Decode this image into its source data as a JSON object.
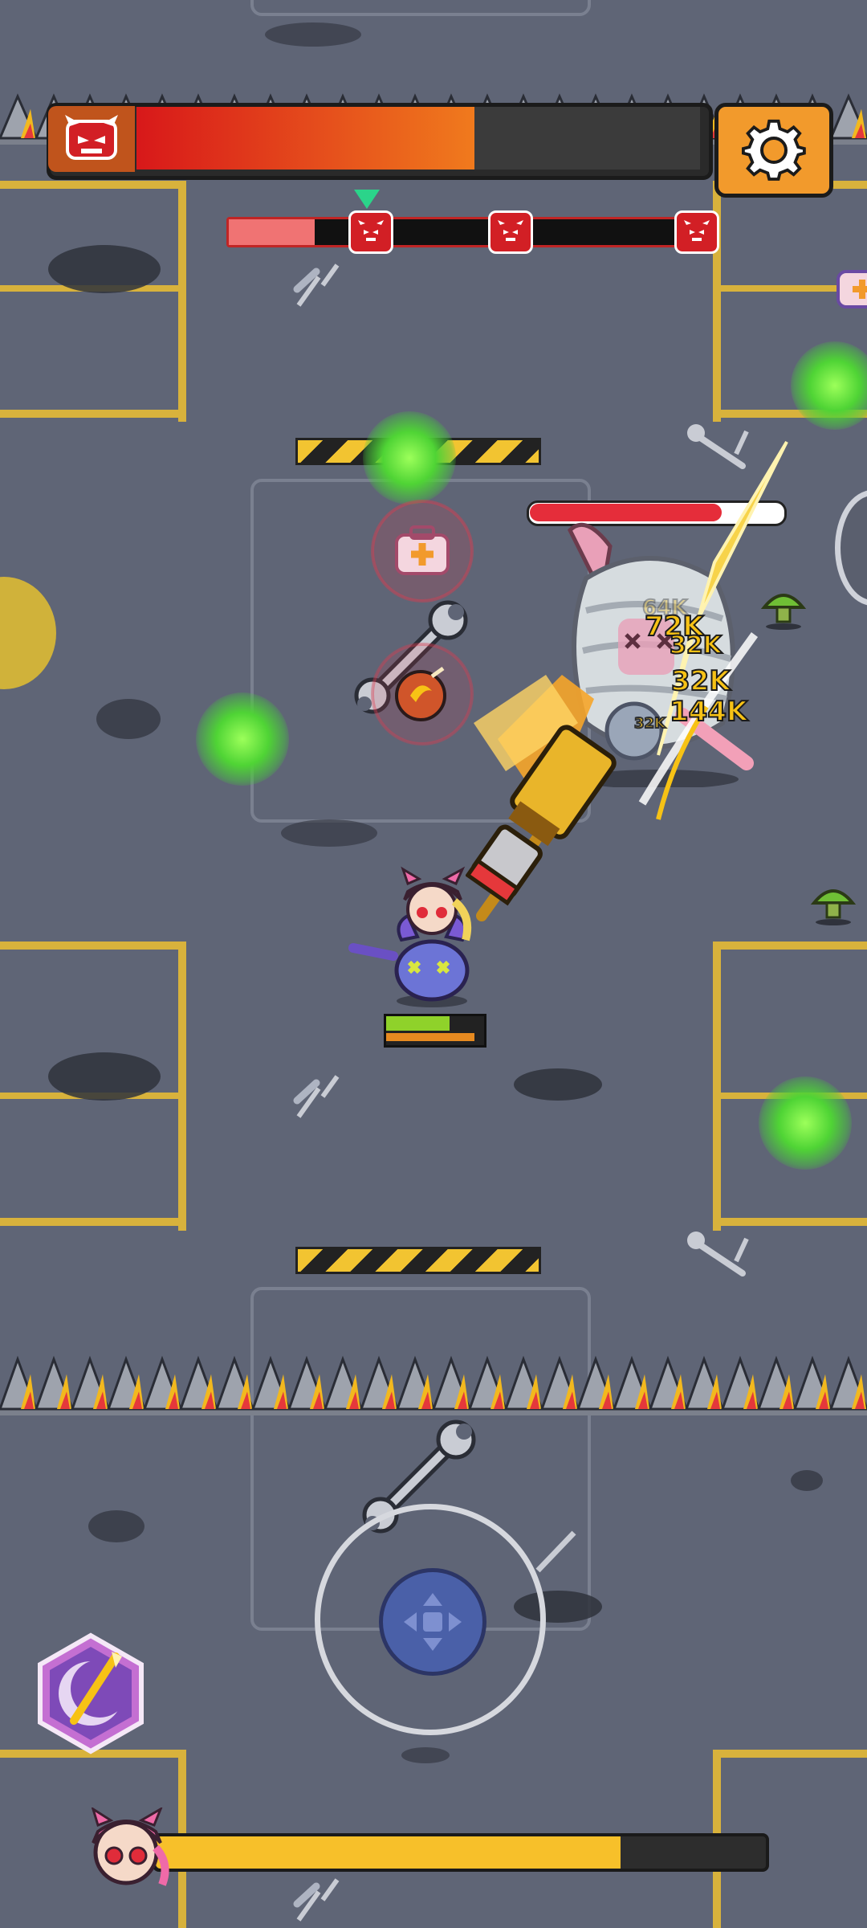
{
  "hud": {
    "boss_health_fraction": 0.6,
    "wave_progress_fraction": 0.18,
    "wave_markers": 3,
    "settings_icon": "gear-icon",
    "boss_icon": "demon-skull-icon"
  },
  "boss": {
    "health_fraction": 0.75
  },
  "damage_numbers": [
    "64K",
    "72K",
    "32K",
    "32K",
    "144K",
    "32K"
  ],
  "player": {
    "health_fraction": 0.68,
    "energy_fraction": 0.95,
    "experience_fraction": 0.77
  },
  "controls": {
    "skill_icon": "golden-sword-moon-icon",
    "joystick_icon": "move-arrows-icon"
  },
  "colors": {
    "boss_bar": "#e0251b",
    "accent_orange": "#f29a2c",
    "exp_bar": "#f7c02a",
    "ground": "#5f6576",
    "lines": "#d8b23c"
  }
}
